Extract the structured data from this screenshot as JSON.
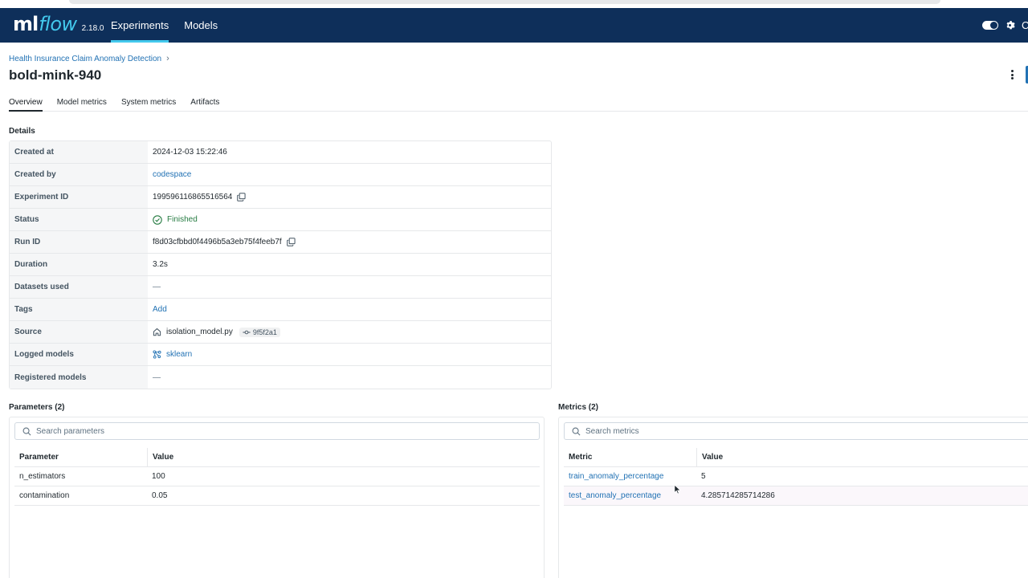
{
  "app": {
    "logo_ml": "ml",
    "logo_flow": "flow",
    "version": "2.18.0",
    "nav": [
      "Experiments",
      "Models"
    ],
    "active_nav": "Experiments",
    "cut_text": "C"
  },
  "breadcrumb": {
    "experiment": "Health Insurance Claim Anomaly Detection",
    "separator": "›"
  },
  "run": {
    "title": "bold-mink-940"
  },
  "tabs": [
    "Overview",
    "Model metrics",
    "System metrics",
    "Artifacts"
  ],
  "details": {
    "heading": "Details",
    "rows": {
      "created_at": {
        "label": "Created at",
        "value": "2024-12-03 15:22:46"
      },
      "created_by": {
        "label": "Created by",
        "value": "codespace"
      },
      "experiment_id": {
        "label": "Experiment ID",
        "value": "199596116865516564"
      },
      "status": {
        "label": "Status",
        "value": "Finished"
      },
      "run_id": {
        "label": "Run ID",
        "value": "f8d03cfbbd0f4496b5a3eb75f4feeb7f"
      },
      "duration": {
        "label": "Duration",
        "value": "3.2s"
      },
      "datasets": {
        "label": "Datasets used",
        "value": "—"
      },
      "tags": {
        "label": "Tags",
        "value": "Add"
      },
      "source": {
        "label": "Source",
        "value": "isolation_model.py",
        "commit": "9f5f2a1"
      },
      "logged_models": {
        "label": "Logged models",
        "value": "sklearn"
      },
      "registered_models": {
        "label": "Registered models",
        "value": "—"
      }
    }
  },
  "parameters": {
    "heading": "Parameters (2)",
    "search_placeholder": "Search parameters",
    "columns": [
      "Parameter",
      "Value"
    ],
    "rows": [
      {
        "name": "n_estimators",
        "value": "100"
      },
      {
        "name": "contamination",
        "value": "0.05"
      }
    ]
  },
  "metrics": {
    "heading": "Metrics (2)",
    "search_placeholder": "Search metrics",
    "columns": [
      "Metric",
      "Value"
    ],
    "rows": [
      {
        "name": "train_anomaly_percentage",
        "value": "5"
      },
      {
        "name": "test_anomaly_percentage",
        "value": "4.285714285714286"
      }
    ]
  },
  "colors": {
    "topbar": "#0e2f5a",
    "brand_accent": "#43c9ed",
    "link": "#2272b4",
    "success": "#277c43"
  },
  "icons": [
    "toggle-switch-icon",
    "gear-icon",
    "chevron-right-icon",
    "kebab-menu-icon",
    "copy-icon",
    "check-circle-icon",
    "home-icon",
    "git-commit-icon",
    "model-icon",
    "search-icon",
    "cursor-icon"
  ]
}
